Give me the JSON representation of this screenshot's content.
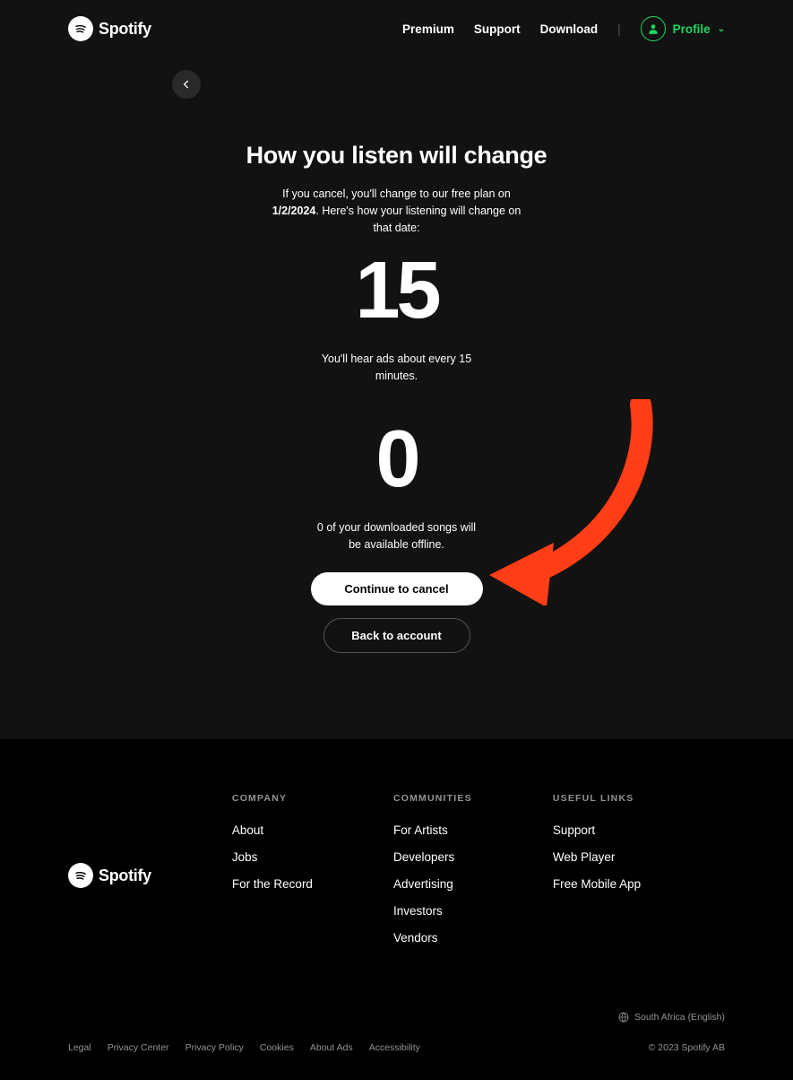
{
  "brand": "Spotify",
  "nav": {
    "premium": "Premium",
    "support": "Support",
    "download": "Download",
    "profile": "Profile"
  },
  "main": {
    "title": "How you listen will change",
    "sub_prefix": "If you cancel, you'll change to our free plan on ",
    "sub_date": "1/2/2024",
    "sub_suffix": ". Here's how your listening will change on that date:",
    "stat1_num": "15",
    "stat1_text": "You'll hear ads about every 15 minutes.",
    "stat2_num": "0",
    "stat2_text": "0 of your downloaded songs will be available offline.",
    "cta_primary": "Continue to cancel",
    "cta_secondary": "Back to account"
  },
  "footer": {
    "col1_h": "COMPANY",
    "col1": [
      "About",
      "Jobs",
      "For the Record"
    ],
    "col2_h": "COMMUNITIES",
    "col2": [
      "For Artists",
      "Developers",
      "Advertising",
      "Investors",
      "Vendors"
    ],
    "col3_h": "USEFUL LINKS",
    "col3": [
      "Support",
      "Web Player",
      "Free Mobile App"
    ],
    "locale": "South Africa (English)",
    "legal": [
      "Legal",
      "Privacy Center",
      "Privacy Policy",
      "Cookies",
      "About Ads",
      "Accessibility"
    ],
    "copyright": "© 2023 Spotify AB"
  }
}
